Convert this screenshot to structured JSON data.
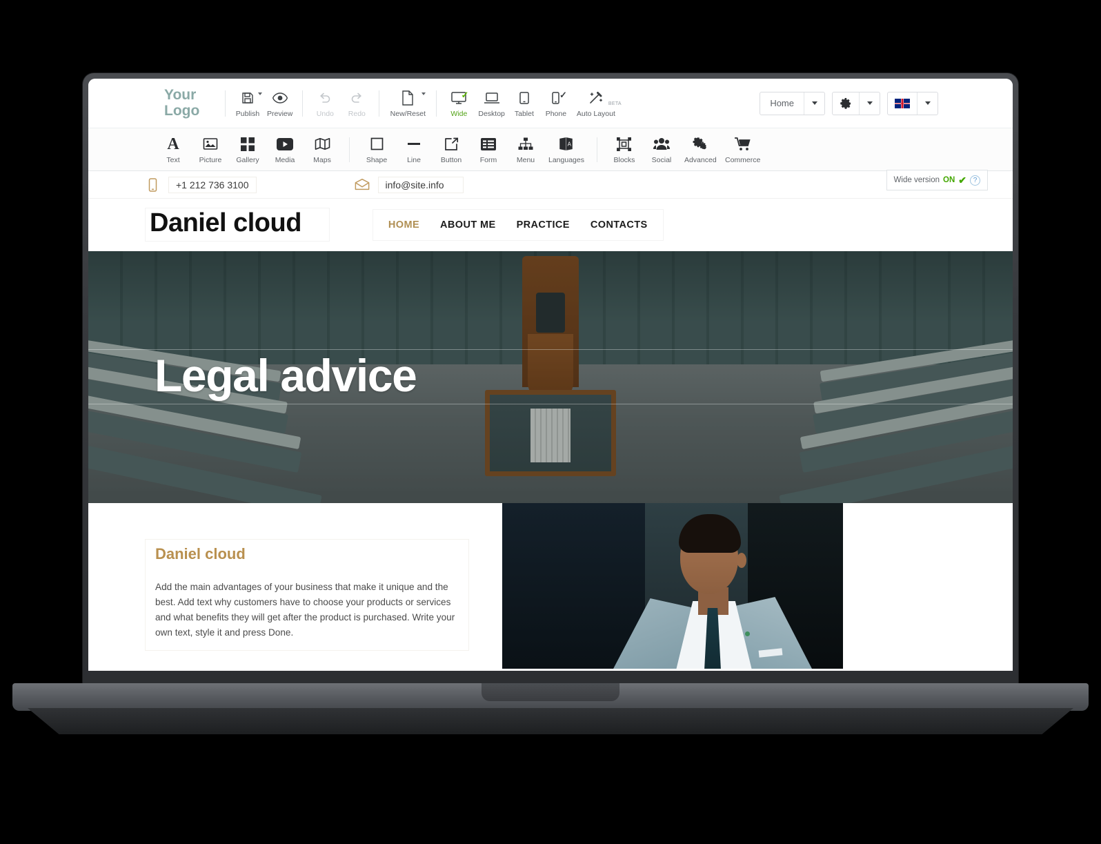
{
  "builder": {
    "logo": {
      "line1": "Your",
      "line2": "Logo",
      "color": "#8aa9a6"
    },
    "top_toolbar": [
      {
        "name": "publish",
        "label": "Publish",
        "icon": "save-icon",
        "has_caret": true,
        "state": "enabled"
      },
      {
        "name": "preview",
        "label": "Preview",
        "icon": "eye-icon",
        "has_caret": false,
        "state": "enabled"
      },
      {
        "name": "undo",
        "label": "Undo",
        "icon": "undo-icon",
        "has_caret": false,
        "state": "disabled"
      },
      {
        "name": "redo",
        "label": "Redo",
        "icon": "redo-icon",
        "has_caret": false,
        "state": "disabled"
      },
      {
        "name": "new-reset",
        "label": "New/Reset",
        "icon": "page-icon",
        "has_caret": true,
        "state": "enabled"
      },
      {
        "name": "wide",
        "label": "Wide",
        "icon": "monitor-icon",
        "has_caret": false,
        "state": "active"
      },
      {
        "name": "desktop",
        "label": "Desktop",
        "icon": "laptop-icon",
        "has_caret": false,
        "state": "enabled"
      },
      {
        "name": "tablet",
        "label": "Tablet",
        "icon": "tablet-icon",
        "has_caret": false,
        "state": "enabled"
      },
      {
        "name": "phone",
        "label": "Phone",
        "icon": "phone-icon",
        "has_caret": false,
        "state": "enabled"
      },
      {
        "name": "auto-layout",
        "label": "Auto Layout",
        "icon": "magic-wand-icon",
        "badge": "BETA",
        "state": "enabled"
      }
    ],
    "page_selector": {
      "value": "Home",
      "icon": "chevron-down-icon"
    },
    "settings_button": {
      "icon": "gear-icon",
      "caret": "chevron-down-icon"
    },
    "language_button": {
      "icon": "uk-flag-icon",
      "caret": "chevron-down-icon"
    },
    "elements_toolbar": [
      {
        "name": "text",
        "label": "Text",
        "icon": "letter-a-icon"
      },
      {
        "name": "picture",
        "label": "Picture",
        "icon": "image-icon"
      },
      {
        "name": "gallery",
        "label": "Gallery",
        "icon": "grid-icon"
      },
      {
        "name": "media",
        "label": "Media",
        "icon": "play-icon"
      },
      {
        "name": "maps",
        "label": "Maps",
        "icon": "map-icon"
      },
      {
        "name": "shape",
        "label": "Shape",
        "icon": "square-icon"
      },
      {
        "name": "line",
        "label": "Line",
        "icon": "line-icon"
      },
      {
        "name": "button",
        "label": "Button",
        "icon": "button-icon"
      },
      {
        "name": "form",
        "label": "Form",
        "icon": "form-icon"
      },
      {
        "name": "menu",
        "label": "Menu",
        "icon": "sitemap-icon"
      },
      {
        "name": "languages",
        "label": "Languages",
        "icon": "languages-icon"
      },
      {
        "name": "blocks",
        "label": "Blocks",
        "icon": "blocks-icon"
      },
      {
        "name": "social",
        "label": "Social",
        "icon": "people-icon"
      },
      {
        "name": "advanced",
        "label": "Advanced",
        "icon": "gears-icon"
      },
      {
        "name": "commerce",
        "label": "Commerce",
        "icon": "cart-icon"
      }
    ],
    "wide_version": {
      "label": "Wide version",
      "state": "ON",
      "check": "✔",
      "help": "?"
    }
  },
  "site": {
    "contact": {
      "phone": "+1 212 736 3100",
      "phone_icon": "mobile-phone-icon",
      "email": "info@site.info",
      "email_icon": "envelope-icon",
      "accent_color": "#c09a5e"
    },
    "logo_text": "Daniel cloud",
    "nav": [
      {
        "label": "HOME",
        "active": true
      },
      {
        "label": "ABOUT ME",
        "active": false
      },
      {
        "label": "PRACTICE",
        "active": false
      },
      {
        "label": "CONTACTS",
        "active": false
      }
    ],
    "nav_active_color": "#b08f53",
    "hero": {
      "title": "Legal advice",
      "image_alt": "parliament chamber interior with teal benches and wooden speaker chair"
    },
    "about": {
      "heading": "Daniel cloud",
      "heading_color": "#b9904f",
      "body": "Add the main advantages of your business that make it unique and the best. Add text why customers have to choose your products or services and what benefits they will get after the product is purchased. Write your own text, style it and press Done.",
      "photo_alt": "man in light blue suit with dark tie looking down"
    }
  }
}
